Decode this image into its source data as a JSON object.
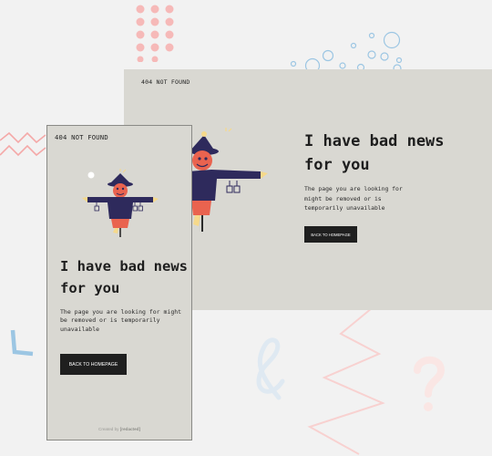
{
  "desktop": {
    "brand": "404 NOT FOUND",
    "title": "I have bad news for you",
    "description": "The page you are looking for might be removed or is temporarily unavailable",
    "button_label": "BACK TO HOMEPAGE"
  },
  "mobile": {
    "brand": "404 NOT FOUND",
    "title": "I have bad news for you",
    "description": "The page you are looking for might be removed or is temporarily unavailable",
    "button_label": "BACK TO HOMEPAGE",
    "footer_prefix": "Created by",
    "footer_author": "[redacted]"
  },
  "colors": {
    "background": "#f2f2f2",
    "card": "#d9d8d2",
    "button": "#1f1f1f",
    "accent_pink": "#f4a9a8",
    "accent_blue": "#9cc6e3",
    "accent_yellow": "#f6d98b",
    "scarecrow_coat": "#2e2a5c",
    "scarecrow_face": "#e9634f"
  },
  "icons": [
    "scarecrow-illustration",
    "dots-decoration",
    "bubbles-decoration",
    "zigzag-decoration",
    "ampersand-decoration",
    "question-mark-decoration",
    "l-shape-decoration"
  ]
}
